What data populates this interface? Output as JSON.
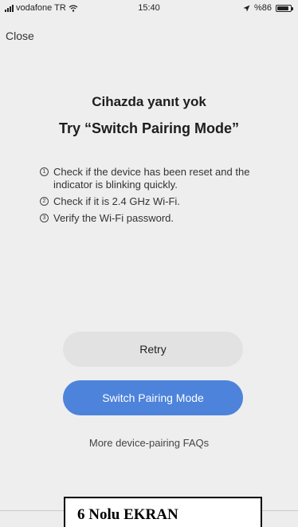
{
  "status_bar": {
    "carrier": "vodafone TR",
    "time": "15:40",
    "battery": "%86",
    "icons": [
      "signal-icon",
      "wifi-icon",
      "location-icon",
      "battery-icon"
    ]
  },
  "nav": {
    "close_label": "Close"
  },
  "message": {
    "title": "Cihazda yanıt yok",
    "subtitle": "Try “Switch Pairing Mode”"
  },
  "steps": [
    {
      "num": "1",
      "text": "Check if the device has been reset and the indicator is blinking quickly."
    },
    {
      "num": "2",
      "text": "Check if it is 2.4 GHz Wi-Fi."
    },
    {
      "num": "3",
      "text": "Verify the Wi-Fi password."
    }
  ],
  "buttons": {
    "retry_label": "Retry",
    "switch_label": "Switch Pairing Mode"
  },
  "faq_label": "More device-pairing FAQs",
  "caption": "6 Nolu EKRAN",
  "colors": {
    "primary": "#4d83db",
    "secondary_button": "#e2e2e2",
    "background": "#eeeeee"
  }
}
